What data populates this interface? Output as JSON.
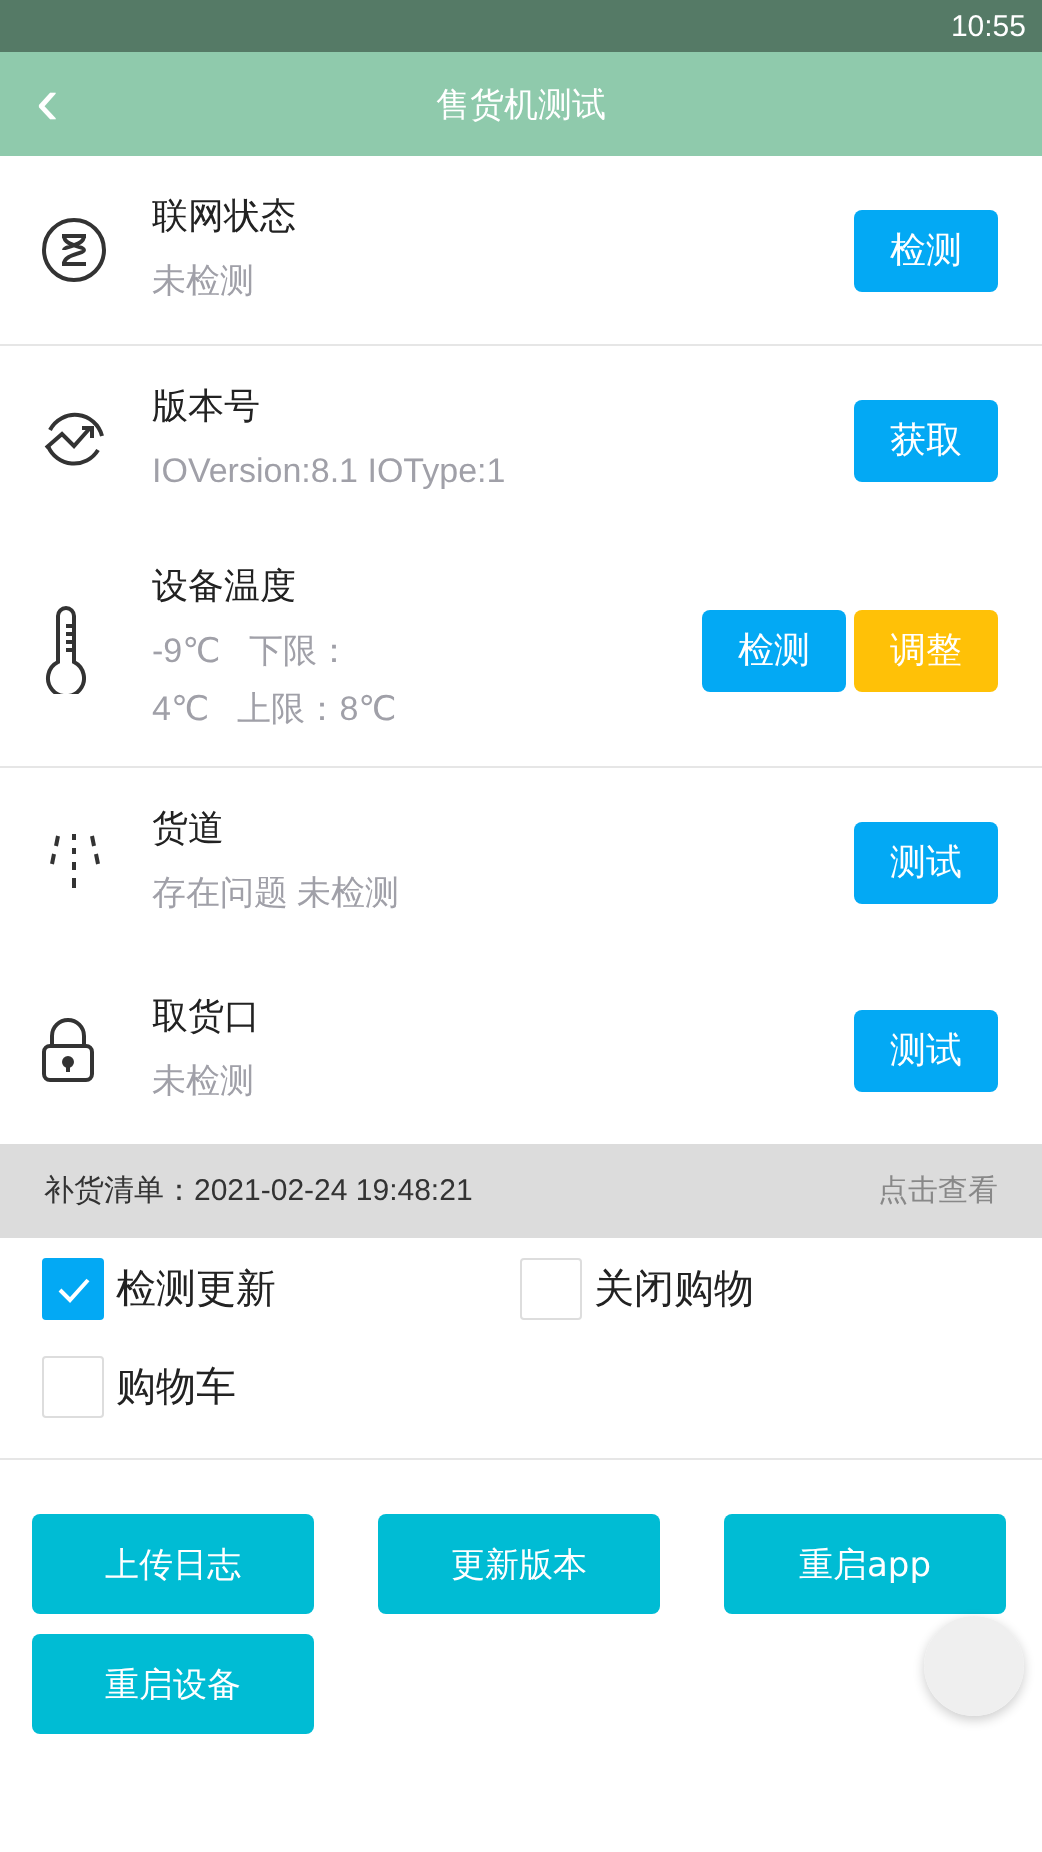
{
  "status_bar": {
    "time": "10:55"
  },
  "header": {
    "back": "‹",
    "title": "售货机测试"
  },
  "sections": [
    {
      "rows": [
        {
          "title": "联网状态",
          "status": [
            "未检测"
          ],
          "buttons": [
            {
              "label": "检测",
              "kind": "primary"
            }
          ]
        }
      ]
    },
    {
      "rows": [
        {
          "title": "版本号",
          "status": [
            "IOVersion:8.1 IOType:1"
          ],
          "buttons": [
            {
              "label": "获取",
              "kind": "primary"
            }
          ]
        },
        {
          "title": "设备温度",
          "status": [
            "-9℃   下限：",
            "4℃   上限：8℃"
          ],
          "buttons": [
            {
              "label": "检测",
              "kind": "primary"
            },
            {
              "label": "调整",
              "kind": "warning"
            }
          ]
        }
      ]
    },
    {
      "rows": [
        {
          "title": "货道",
          "status": [
            "存在问题 未检测"
          ],
          "buttons": [
            {
              "label": "测试",
              "kind": "primary"
            }
          ]
        },
        {
          "title": "取货口",
          "status": [
            "未检测"
          ],
          "buttons": [
            {
              "label": "测试",
              "kind": "primary"
            }
          ]
        }
      ]
    }
  ],
  "restock_bar": {
    "label": "补货清单：2021-02-24 19:48:21",
    "action": "点击查看"
  },
  "options": [
    {
      "label": "检测更新",
      "checked": true
    },
    {
      "label": "关闭购物",
      "checked": false
    },
    {
      "label": "购物车",
      "checked": false
    }
  ],
  "actions": [
    "上传日志",
    "更新版本",
    "重启app",
    "重启设备"
  ]
}
